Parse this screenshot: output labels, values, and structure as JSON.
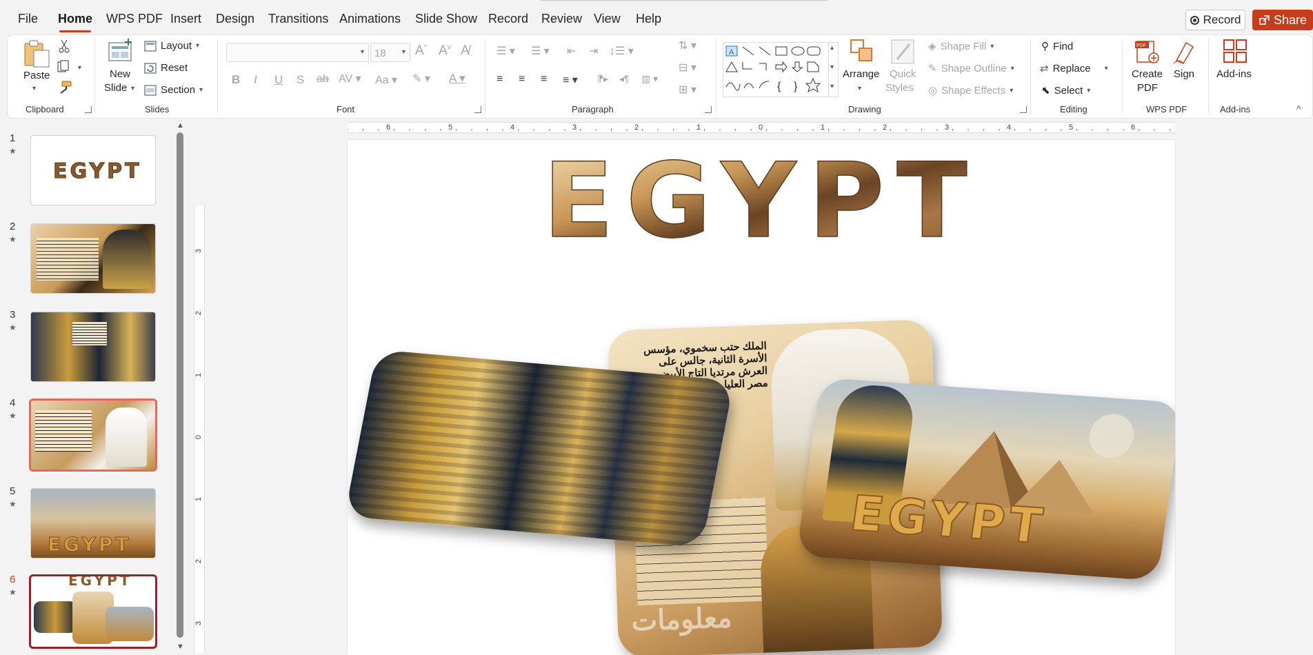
{
  "menu": {
    "tabs": [
      "File",
      "Home",
      "WPS PDF",
      "Insert",
      "Design",
      "Transitions",
      "Animations",
      "Slide Show",
      "Record",
      "Review",
      "View",
      "Help"
    ],
    "active_tab": "Home",
    "record_label": "Record",
    "share_label": "Share"
  },
  "ribbon": {
    "clipboard": {
      "paste": "Paste",
      "group": "Clipboard"
    },
    "slides": {
      "new_slide_1": "New",
      "new_slide_2": "Slide",
      "layout": "Layout",
      "reset": "Reset",
      "section": "Section",
      "group": "Slides"
    },
    "font": {
      "size": "18",
      "group": "Font"
    },
    "paragraph": {
      "group": "Paragraph"
    },
    "drawing": {
      "arrange": "Arrange",
      "quick_styles_1": "Quick",
      "quick_styles_2": "Styles",
      "shape_fill": "Shape Fill",
      "shape_outline": "Shape Outline",
      "shape_effects": "Shape Effects",
      "group": "Drawing"
    },
    "editing": {
      "find": "Find",
      "replace": "Replace",
      "select": "Select",
      "group": "Editing"
    },
    "wps_pdf": {
      "create_1": "Create",
      "create_2": "PDF",
      "sign": "Sign",
      "group": "WPS PDF"
    },
    "addins": {
      "label": "Add-ins",
      "group": "Add-ins"
    }
  },
  "slides": [
    {
      "num": "1",
      "star": "★",
      "thumb_text": "EGYPT"
    },
    {
      "num": "2",
      "star": "★"
    },
    {
      "num": "3",
      "star": "★"
    },
    {
      "num": "4",
      "star": "★"
    },
    {
      "num": "5",
      "star": "★",
      "thumb_text": "EGYPT"
    },
    {
      "num": "6",
      "star": "★",
      "thumb_text": "EGYPT"
    }
  ],
  "ruler": {
    "h_ticks": [
      "6",
      "5",
      "4",
      "3",
      "2",
      "1",
      "0",
      "1",
      "2",
      "3",
      "4",
      "5",
      "6"
    ],
    "v_ticks": [
      "3",
      "2",
      "1",
      "0",
      "1",
      "2",
      "3"
    ]
  },
  "slide": {
    "title": "EGYPT",
    "card_text": "EGYPT",
    "arabic_text": "الملك حتب سخموي، مؤسس الأسرة الثانية، جالس على العرش مرتديا التاج الأبيض من مصر العليا",
    "watermark": "معلومات"
  },
  "colors": {
    "accent": "#c43e1c",
    "gold": "#c9963b",
    "sand": "#d8b37a",
    "brown": "#6b4424"
  }
}
